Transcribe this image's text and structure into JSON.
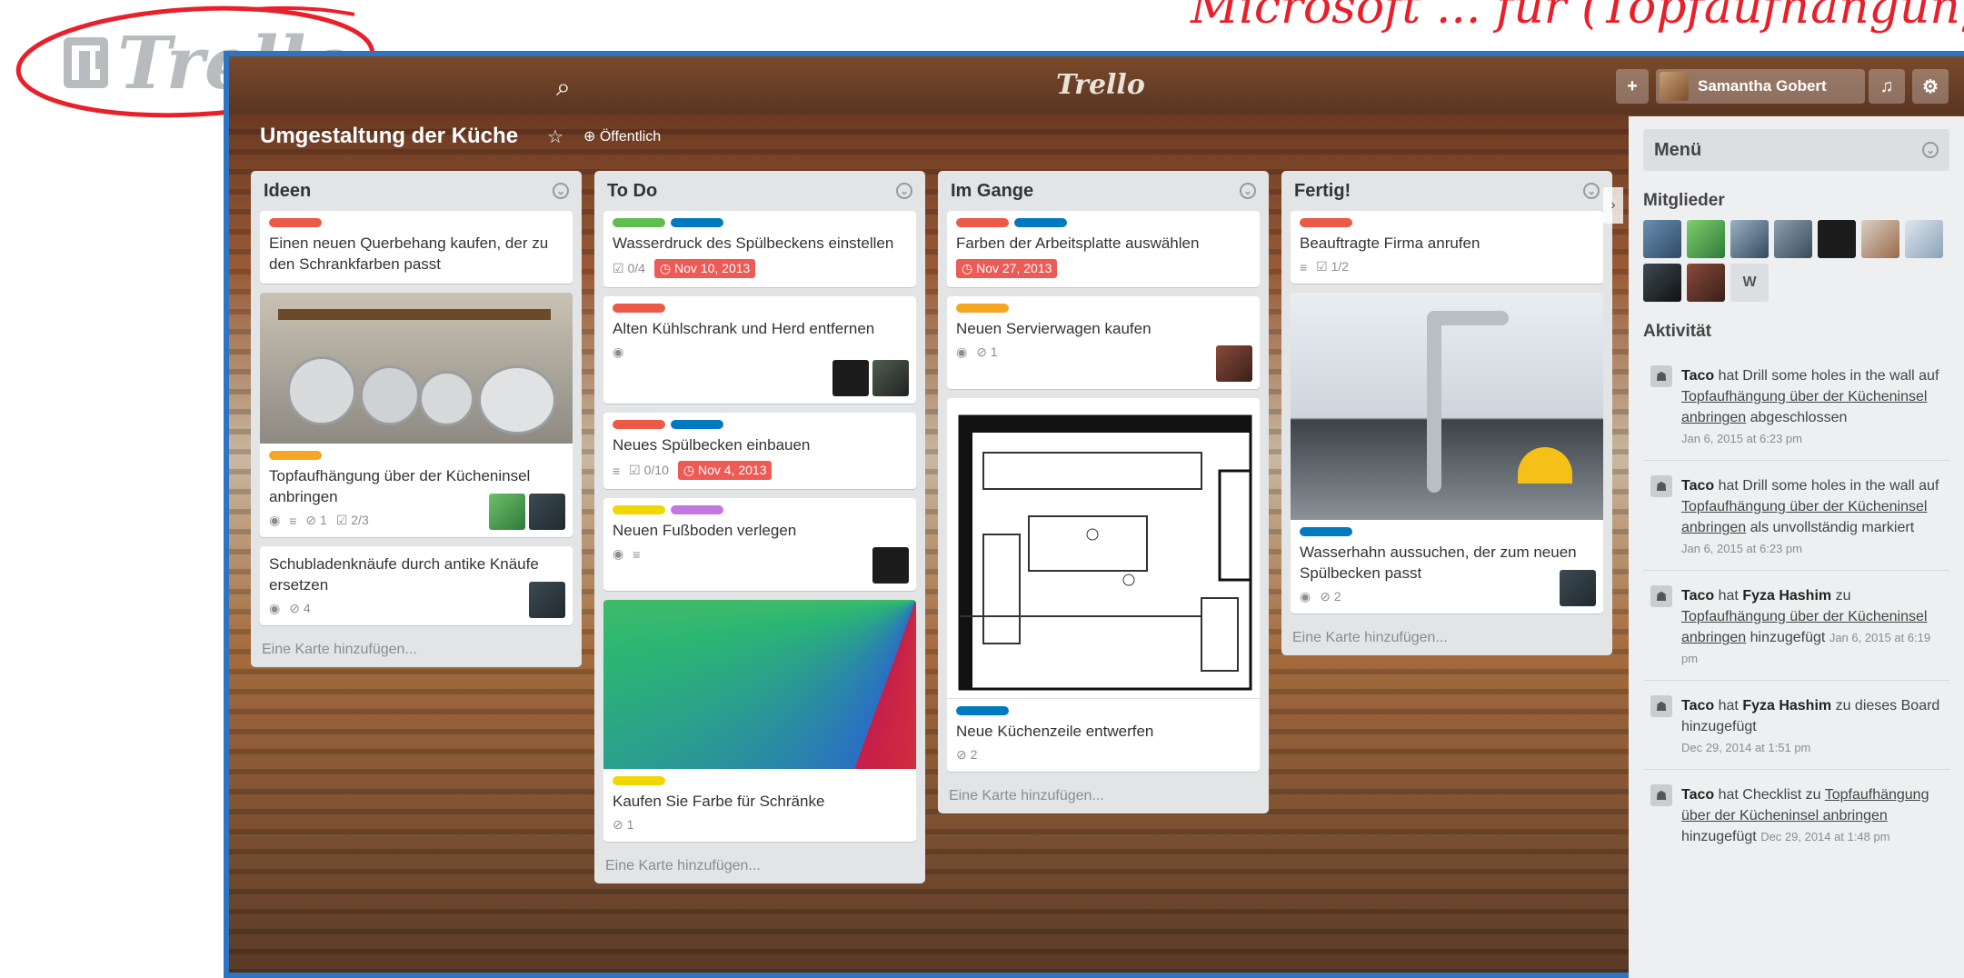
{
  "overlay": {
    "logo_text": "Trello",
    "handwriting_top": "Microsoft ... für (Topfaufhängung)"
  },
  "header": {
    "center_logo": "Trello",
    "add_button": "+",
    "user_name": "Samantha Gobert",
    "bell_icon": "bell-icon",
    "gear_icon": "gear-icon"
  },
  "board": {
    "title": "Umgestaltung der Küche",
    "visibility": "Öffentlich"
  },
  "lists": [
    {
      "name": "Ideen",
      "add_card": "Eine Karte hinzufügen...",
      "cards": [
        {
          "title": "Einen neuen Querbehang kaufen, der zu den Schrankfarben passt",
          "labels": [
            "#eb5a46"
          ]
        },
        {
          "title": "Topfaufhängung über der Kücheninsel anbringen",
          "labels": [
            "#f5a623"
          ],
          "badges": {
            "attachments": "1",
            "checklist": "2/3"
          }
        },
        {
          "title": "Schubladenknäufe durch antike Knäufe ersetzen",
          "badges": {
            "attachments": "4"
          }
        }
      ]
    },
    {
      "name": "To Do",
      "add_card": "Eine Karte hinzufügen...",
      "cards": [
        {
          "title": "Wasserdruck des Spülbeckens einstellen",
          "labels": [
            "#61bd4f",
            "#0079bf"
          ],
          "badges": {
            "checklist": "0/4",
            "due": "Nov 10, 2013"
          }
        },
        {
          "title": "Alten Kühlschrank und Herd entfernen",
          "labels": [
            "#eb5a46"
          ]
        },
        {
          "title": "Neues Spülbecken einbauen",
          "labels": [
            "#eb5a46",
            "#0079bf"
          ],
          "badges": {
            "checklist": "0/10",
            "due": "Nov 4, 2013"
          }
        },
        {
          "title": "Neuen Fußboden verlegen",
          "labels": [
            "#f2d600",
            "#c377e0"
          ]
        },
        {
          "title": "Kaufen Sie Farbe für Schränke",
          "labels": [
            "#f2d600"
          ],
          "badges": {
            "attachments": "1"
          }
        }
      ]
    },
    {
      "name": "Im Gange",
      "add_card": "Eine Karte hinzufügen...",
      "cards": [
        {
          "title": "Farben der Arbeitsplatte auswählen",
          "labels": [
            "#eb5a46",
            "#0079bf"
          ],
          "badges": {
            "due": "Nov 27, 2013"
          }
        },
        {
          "title": "Neuen Servierwagen kaufen",
          "labels": [
            "#f5a623"
          ],
          "badges": {
            "attachments": "1"
          }
        },
        {
          "title": "Neue Küchenzeile entwerfen",
          "labels": [
            "#0079bf"
          ],
          "badges": {
            "attachments": "2"
          }
        }
      ]
    },
    {
      "name": "Fertig!",
      "add_card": "Eine Karte hinzufügen...",
      "cards": [
        {
          "title": "Beauftragte Firma anrufen",
          "labels": [
            "#eb5a46"
          ],
          "badges": {
            "checklist": "1/2"
          }
        },
        {
          "title": "Wasserhahn aussuchen, der zum neuen Spülbecken passt",
          "labels": [
            "#0079bf"
          ],
          "badges": {
            "attachments": "2"
          }
        }
      ]
    }
  ],
  "menu": {
    "title": "Menü",
    "members_title": "Mitglieder",
    "member_letter": "W",
    "activity_title": "Aktivität",
    "activities": [
      {
        "user": "Taco",
        "pre": "hat Drill some holes in the wall auf",
        "link": "Topfaufhängung über der Kücheninsel anbringen",
        "post": "abgeschlossen",
        "time": "Jan 6, 2015 at 6:23 pm"
      },
      {
        "user": "Taco",
        "pre": "hat Drill some holes in the wall auf",
        "link": "Topfaufhängung über der Kücheninsel anbringen",
        "post": "als unvollständig markiert",
        "time": "Jan 6, 2015 at 6:23 pm"
      },
      {
        "user": "Taco",
        "pre": "hat",
        "bold2": "Fyza Hashim",
        "pre2": "zu",
        "link": "Topfaufhängung über der Kücheninsel anbringen",
        "post": "hinzugefügt",
        "time": "Jan 6, 2015 at 6:19 pm"
      },
      {
        "user": "Taco",
        "pre": "hat",
        "bold2": "Fyza Hashim",
        "pre2": "zu dieses Board hinzugefügt",
        "time": "Dec 29, 2014 at 1:51 pm"
      },
      {
        "user": "Taco",
        "pre": "hat Checklist zu",
        "link": "Topfaufhängung über der Kücheninsel anbringen",
        "post": "hinzugefügt",
        "time": "Dec 29, 2014 at 1:48 pm"
      }
    ]
  }
}
